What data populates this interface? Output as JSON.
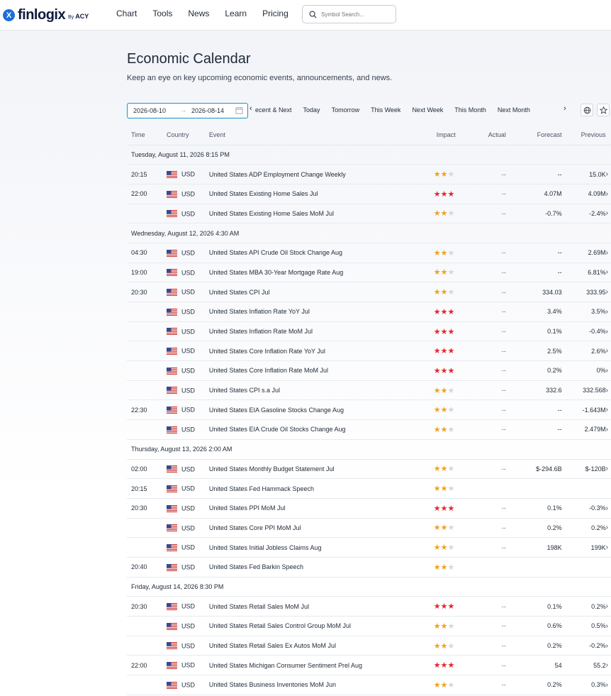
{
  "brand": {
    "name": "finlogix",
    "by": "By",
    "partner": "ACY",
    "mark": "X"
  },
  "nav": [
    "Chart",
    "Tools",
    "News",
    "Learn",
    "Pricing"
  ],
  "search": {
    "placeholder": "Symbol Search..."
  },
  "page": {
    "title": "Economic Calendar",
    "subtitle": "Keep an eye on key upcoming economic events, announcements, and news."
  },
  "filters": {
    "date_from": "2026-08-10",
    "date_to": "2026-08-14",
    "arrow": "→",
    "quick": [
      "ecent & Next",
      "Today",
      "Tomorrow",
      "This Week",
      "Next Week",
      "This Month",
      "Next Month"
    ],
    "prev_chevron": "‹",
    "next_chevron": "›"
  },
  "columns": {
    "time": "Time",
    "country": "Country",
    "event": "Event",
    "impact": "Impact",
    "actual": "Actual",
    "forecast": "Forecast",
    "previous": "Previous"
  },
  "colors": {
    "accent": "#1e90c8",
    "star_medium": "#f0a020",
    "star_high": "#e5252a",
    "star_off": "#d4d6db"
  },
  "groups": [
    {
      "date": "Tuesday, August 11, 2026 8:15 PM",
      "events": [
        {
          "time": "20:15",
          "currency": "USD",
          "event": "United States ADP Employment Change Weekly",
          "impact": 2,
          "actual": "--",
          "forecast": "--",
          "previous": "15.0K",
          "arrow": "›"
        },
        {
          "time": "22:00",
          "currency": "USD",
          "event": "United States Existing Home Sales Jul",
          "impact": 3,
          "actual": "--",
          "forecast": "4.07M",
          "previous": "4.09M",
          "arrow": "›"
        },
        {
          "time": "",
          "currency": "USD",
          "event": "United States Existing Home Sales MoM Jul",
          "impact": 2,
          "actual": "--",
          "forecast": "-0.7%",
          "previous": "-2.4%",
          "arrow": "›"
        }
      ]
    },
    {
      "date": "Wednesday, August 12, 2026 4:30 AM",
      "events": [
        {
          "time": "04:30",
          "currency": "USD",
          "event": "United States API Crude Oil Stock Change Aug",
          "impact": 2,
          "actual": "--",
          "forecast": "--",
          "previous": "2.69M",
          "arrow": "›"
        },
        {
          "time": "19:00",
          "currency": "USD",
          "event": "United States MBA 30-Year Mortgage Rate Aug",
          "impact": 2,
          "actual": "--",
          "forecast": "--",
          "previous": "6.81%",
          "arrow": "›"
        },
        {
          "time": "20:30",
          "currency": "USD",
          "event": "United States CPI Jul",
          "impact": 2,
          "actual": "--",
          "forecast": "334.03",
          "previous": "333.95",
          "arrow": "›"
        },
        {
          "time": "",
          "currency": "USD",
          "event": "United States Inflation Rate YoY Jul",
          "impact": 3,
          "actual": "--",
          "forecast": "3.4%",
          "previous": "3.5%",
          "arrow": "›"
        },
        {
          "time": "",
          "currency": "USD",
          "event": "United States Inflation Rate MoM Jul",
          "impact": 3,
          "actual": "--",
          "forecast": "0.1%",
          "previous": "-0.4%",
          "arrow": "›"
        },
        {
          "time": "",
          "currency": "USD",
          "event": "United States Core Inflation Rate YoY Jul",
          "impact": 3,
          "actual": "--",
          "forecast": "2.5%",
          "previous": "2.6%",
          "arrow": "›"
        },
        {
          "time": "",
          "currency": "USD",
          "event": "United States Core Inflation Rate MoM Jul",
          "impact": 3,
          "actual": "--",
          "forecast": "0.2%",
          "previous": "0%",
          "arrow": "›"
        },
        {
          "time": "",
          "currency": "USD",
          "event": "United States CPI s.a Jul",
          "impact": 2,
          "actual": "--",
          "forecast": "332.6",
          "previous": "332.568",
          "arrow": "›"
        },
        {
          "time": "22:30",
          "currency": "USD",
          "event": "United States EIA Gasoline Stocks Change Aug",
          "impact": 2,
          "actual": "--",
          "forecast": "--",
          "previous": "-1.643M",
          "arrow": "›"
        },
        {
          "time": "",
          "currency": "USD",
          "event": "United States EIA Crude Oil Stocks Change Aug",
          "impact": 2,
          "actual": "--",
          "forecast": "--",
          "previous": "2.479M",
          "arrow": "›"
        }
      ]
    },
    {
      "date": "Thursday, August 13, 2026 2:00 AM",
      "events": [
        {
          "time": "02:00",
          "currency": "USD",
          "event": "United States Monthly Budget Statement Jul",
          "impact": 2,
          "actual": "--",
          "forecast": "$-294.6B",
          "previous": "$-120B",
          "arrow": "›"
        },
        {
          "time": "20:15",
          "currency": "USD",
          "event": "United States Fed Hammack Speech",
          "impact": 2,
          "actual": "",
          "forecast": "",
          "previous": "",
          "arrow": ""
        },
        {
          "time": "20:30",
          "currency": "USD",
          "event": "United States PPI MoM Jul",
          "impact": 3,
          "actual": "--",
          "forecast": "0.1%",
          "previous": "-0.3%",
          "arrow": "›"
        },
        {
          "time": "",
          "currency": "USD",
          "event": "United States Core PPI MoM Jul",
          "impact": 2,
          "actual": "--",
          "forecast": "0.2%",
          "previous": "0.2%",
          "arrow": "›"
        },
        {
          "time": "",
          "currency": "USD",
          "event": "United States Initial Jobless Claims Aug",
          "impact": 2,
          "actual": "--",
          "forecast": "198K",
          "previous": "199K",
          "arrow": "›"
        },
        {
          "time": "20:40",
          "currency": "USD",
          "event": "United States Fed Barkin Speech",
          "impact": 2,
          "actual": "",
          "forecast": "",
          "previous": "",
          "arrow": ""
        }
      ]
    },
    {
      "date": "Friday, August 14, 2026 8:30 PM",
      "events": [
        {
          "time": "20:30",
          "currency": "USD",
          "event": "United States Retail Sales MoM Jul",
          "impact": 3,
          "actual": "--",
          "forecast": "0.1%",
          "previous": "0.2%",
          "arrow": "›"
        },
        {
          "time": "",
          "currency": "USD",
          "event": "United States Retail Sales Control Group MoM Jul",
          "impact": 2,
          "actual": "--",
          "forecast": "0.6%",
          "previous": "0.5%",
          "arrow": "›"
        },
        {
          "time": "",
          "currency": "USD",
          "event": "United States Retail Sales Ex Autos MoM Jul",
          "impact": 2,
          "actual": "--",
          "forecast": "0.2%",
          "previous": "-0.2%",
          "arrow": "›"
        },
        {
          "time": "22:00",
          "currency": "USD",
          "event": "United States Michigan Consumer Sentiment Prel Aug",
          "impact": 3,
          "actual": "--",
          "forecast": "54",
          "previous": "55.2",
          "arrow": "›"
        },
        {
          "time": "",
          "currency": "USD",
          "event": "United States Business Inventories MoM Jun",
          "impact": 2,
          "actual": "--",
          "forecast": "0.2%",
          "previous": "0.3%",
          "arrow": "›"
        }
      ]
    }
  ]
}
